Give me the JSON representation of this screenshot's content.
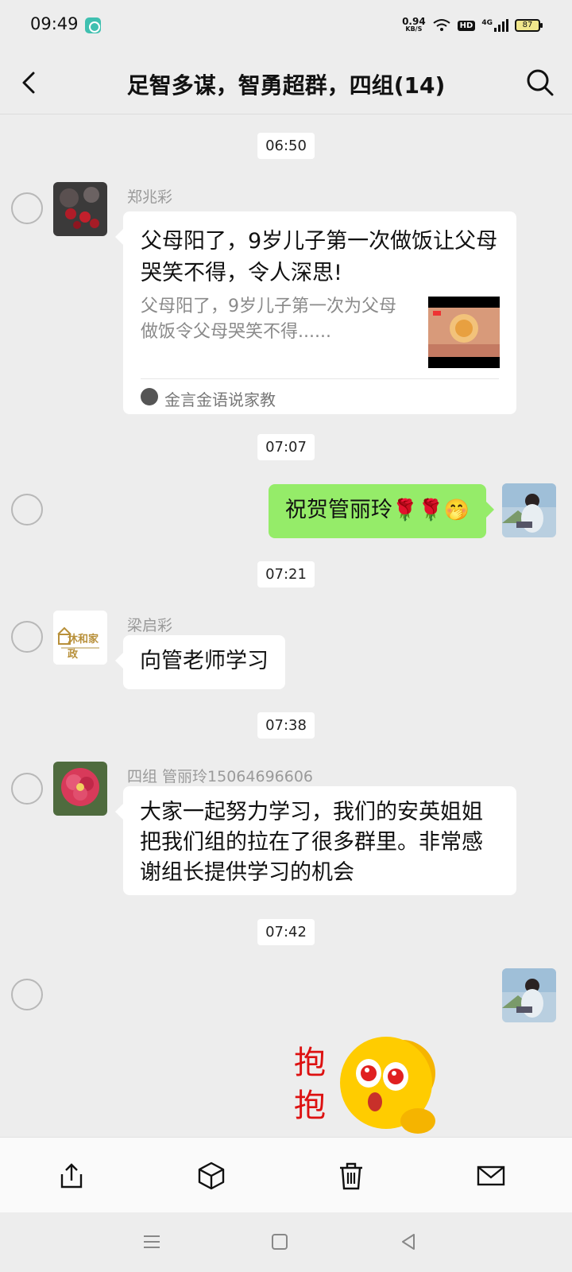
{
  "status_bar": {
    "time": "09:49",
    "net_speed_value": "0.94",
    "net_speed_unit": "KB/S",
    "hd_label": "HD",
    "network_label": "4G",
    "battery": "87"
  },
  "header": {
    "title": "足智多谋，智勇超群，四组(14)",
    "back_icon": "chevron-left-icon",
    "search_icon": "search-icon"
  },
  "messages": [
    {
      "type": "timestamp",
      "text": "06:50"
    },
    {
      "type": "link-card",
      "sender": "郑兆彩",
      "card_title": "父母阳了，9岁儿子第一次做饭让父母哭笑不得，令人深思!",
      "card_desc": "父母阳了，9岁儿子第一次为父母做饭令父母哭笑不得......",
      "card_source": "金言金语说家教"
    },
    {
      "type": "timestamp",
      "text": "07:07"
    },
    {
      "type": "text-out",
      "text": "祝贺管丽玲",
      "emojis": "🌹🌹🤭"
    },
    {
      "type": "timestamp",
      "text": "07:21"
    },
    {
      "type": "text-in",
      "sender": "梁启彩",
      "text": "向管老师学习",
      "avatar_logo_text": "沐和家政"
    },
    {
      "type": "timestamp",
      "text": "07:38"
    },
    {
      "type": "text-in",
      "sender": "四组   管丽玲15064696606",
      "text": "大家一起努力学习，我们的安英姐姐把我们组的拉在了很多群里。非常感谢组长提供学习的机会"
    },
    {
      "type": "timestamp",
      "text": "07:42"
    },
    {
      "type": "sticker-out",
      "sticker_text": "抱抱"
    }
  ],
  "action_bar": {
    "items": [
      "share-icon",
      "box-icon",
      "delete-icon",
      "mail-icon"
    ]
  },
  "nav_bar": {
    "items": [
      "menu-icon",
      "home-icon",
      "back-icon"
    ]
  },
  "colors": {
    "background": "#ededed",
    "outgoing_bubble": "#95ec69",
    "incoming_bubble": "#ffffff"
  }
}
